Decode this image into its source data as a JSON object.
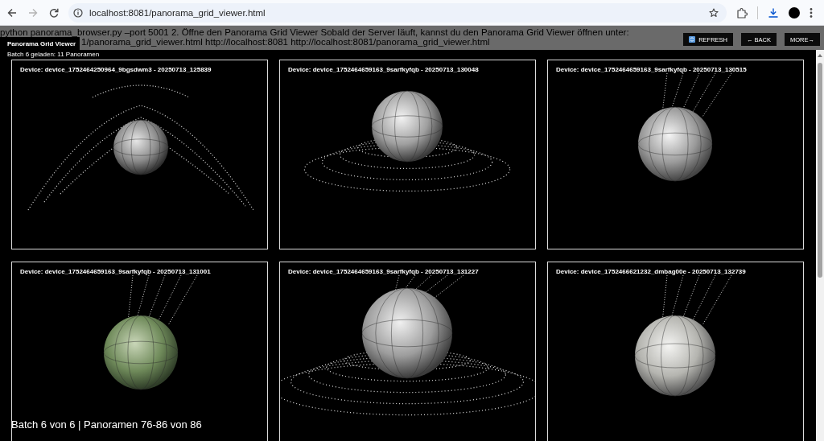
{
  "browser": {
    "url": "localhost:8081/panorama_grid_viewer.html",
    "back_disabled": false,
    "forward_disabled": true
  },
  "background_text": [
    "python panorama_browser.py –port 5001 2. Öffne den Panorama Grid Viewer Sobald der Server läuft, kannst du den Panorama Grid Viewer öffnen unter:",
    "1/panorama_grid_viewer.html http://localhost:8081 http://localhost:8081/panorama_grid_viewer.html"
  ],
  "header": {
    "title": "Panorama Grid Viewer",
    "subtitle": "Batch 6 geladen: 11 Panoramen",
    "buttons": [
      {
        "label": "REFRESH",
        "kind": "icon"
      },
      {
        "label": "← BACK",
        "kind": "text"
      },
      {
        "label": "MORE→",
        "kind": "text"
      }
    ]
  },
  "panoramas": [
    {
      "label": "Device: device_1752464250964_9bgsdwm3 - 20250713_125839"
    },
    {
      "label": "Device: device_1752464659163_9sarfkyfqb - 20250713_130048"
    },
    {
      "label": "Device: device_1752464659163_9sarfkyfqb - 20250713_130515"
    },
    {
      "label": "Device: device_1752464659163_9sarfkyfqb - 20250713_131001"
    },
    {
      "label": "Device: device_1752464659163_9sarfkyfqb - 20250713_131227"
    },
    {
      "label": "Device: device_1752466621232_dmbag00e - 20250713_132739"
    }
  ],
  "status": "Batch 6 von 6 | Panoramen 76-86 von 86"
}
